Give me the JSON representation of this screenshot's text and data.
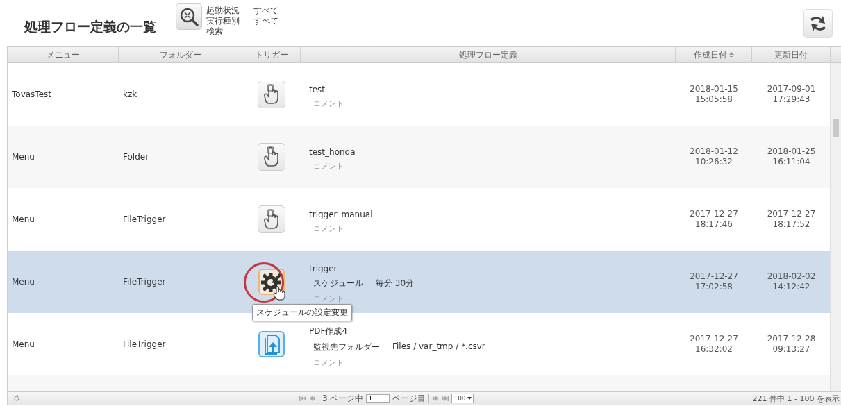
{
  "page_title": "処理フロー定義の一覧",
  "filters": [
    {
      "label": "起動状況",
      "value": "すべて"
    },
    {
      "label": "実行種別",
      "value": "すべて"
    }
  ],
  "search_link": "検索",
  "table": {
    "columns": [
      {
        "label": "メニュー",
        "sorted": false
      },
      {
        "label": "フォルダー",
        "sorted": false
      },
      {
        "label": "トリガー",
        "sorted": false
      },
      {
        "label": "処理フロー定義",
        "sorted": false
      },
      {
        "label": "作成日付",
        "sorted": true
      },
      {
        "label": "更新日付",
        "sorted": false
      }
    ],
    "rows": [
      {
        "menu": "TovasTest",
        "folder": "kzk",
        "kind": "manual",
        "name": "test",
        "details": [],
        "comment": "コメント",
        "created": [
          "2018-01-15",
          "15:05:58"
        ],
        "updated": [
          "2017-09-01",
          "17:29:43"
        ],
        "selected": false
      },
      {
        "menu": "Menu",
        "folder": "Folder",
        "kind": "manual",
        "name": "test_honda",
        "details": [],
        "comment": "コメント",
        "created": [
          "2018-01-12",
          "10:26:32"
        ],
        "updated": [
          "2018-01-25",
          "16:11:04"
        ],
        "selected": false
      },
      {
        "menu": "Menu",
        "folder": "FileTrigger",
        "kind": "manual",
        "name": "trigger_manual",
        "details": [],
        "comment": "コメント",
        "created": [
          "2017-12-27",
          "18:17:46"
        ],
        "updated": [
          "2017-12-27",
          "18:17:52"
        ],
        "selected": false
      },
      {
        "menu": "Menu",
        "folder": "FileTrigger",
        "kind": "schedule",
        "name": "trigger",
        "details": [
          {
            "label": "スケジュール",
            "value": "毎分 30分"
          }
        ],
        "comment": "コメント",
        "created": [
          "2017-12-27",
          "17:02:58"
        ],
        "updated": [
          "2018-02-02",
          "14:12:42"
        ],
        "selected": true,
        "tooltip": "スケジュールの設定変更"
      },
      {
        "menu": "Menu",
        "folder": "FileTrigger",
        "kind": "file",
        "name": "PDF作成4",
        "details": [
          {
            "label": "監視先フォルダー",
            "value": "Files / var_tmp / *.csvr"
          }
        ],
        "comment": "コメント",
        "created": [
          "2017-12-27",
          "16:32:02"
        ],
        "updated": [
          "2017-12-28",
          "09:13:27"
        ],
        "selected": false
      }
    ]
  },
  "pager": {
    "page_count_label": "3 ページ中",
    "page": "1",
    "page_suffix": "ページ目",
    "page_size": "100",
    "summary": "221 件中 1 - 100 を表示"
  }
}
